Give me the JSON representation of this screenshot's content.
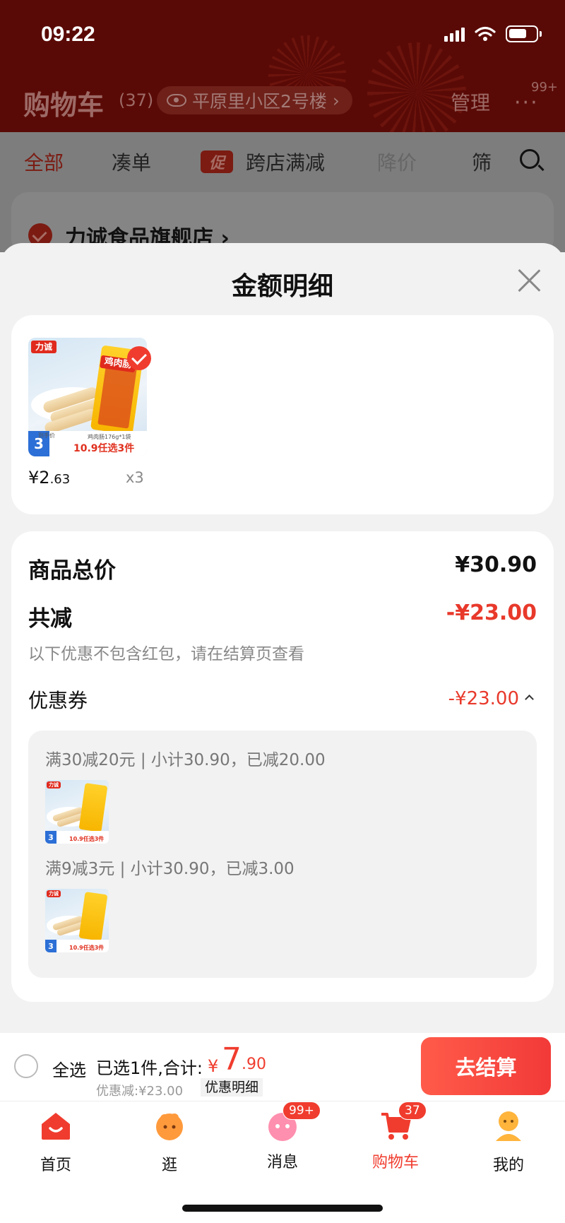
{
  "status_bar": {
    "time": "09:22"
  },
  "header": {
    "title": "购物车",
    "count": "(37)",
    "address": "平原里小区2号楼",
    "manage": "管理",
    "more_badge": "99+"
  },
  "filter_tabs": [
    {
      "label": "全部",
      "active": true
    },
    {
      "label": "凑单"
    },
    {
      "label": "跨店满减",
      "badge": "促"
    },
    {
      "label": "降价"
    },
    {
      "label": "筛"
    }
  ],
  "store": {
    "name": "力诚食品旗舰店 ›"
  },
  "sheet": {
    "title": "金额明细",
    "product": {
      "price_symbol": "¥",
      "price_int": "2",
      "price_dec": ".63",
      "quantity": "x3",
      "thumb": {
        "logo": "力诚",
        "pack_label": "鸡肉肠",
        "spec": "鸡肉肠176g*1袋",
        "unit_price": "3.63/件",
        "promo": "10.9任选3件",
        "tag": "到手价"
      }
    },
    "total_label": "商品总价",
    "total_value": "¥30.90",
    "reduction_label": "共减",
    "reduction_value": "-¥23.00",
    "note": "以下优惠不包含红包，请在结算页查看",
    "coupon_label": "优惠券",
    "coupon_value": "-¥23.00",
    "coupon_rules": [
      "满30减20元 | 小计30.90，已减20.00",
      "满9减3元 | 小计30.90，已减3.00"
    ]
  },
  "checkout": {
    "select_all": "全选",
    "summary": "已选1件,合计:",
    "yen": "¥",
    "total_int": "7",
    "total_dec": ".90",
    "discount_line": "优惠减:¥23.00",
    "discount_detail": "优惠明细",
    "button": "去结算"
  },
  "tabbar": [
    {
      "label": "首页",
      "icon": "home-icon"
    },
    {
      "label": "逛",
      "icon": "browse-icon"
    },
    {
      "label": "消息",
      "icon": "message-icon",
      "badge": "99+"
    },
    {
      "label": "购物车",
      "icon": "cart-icon",
      "badge": "37",
      "active": true
    },
    {
      "label": "我的",
      "icon": "profile-icon"
    }
  ],
  "colors": {
    "accent": "#f03c2e",
    "dim_header": "#5a0a06",
    "sheet_bg": "#f2f2f2"
  }
}
